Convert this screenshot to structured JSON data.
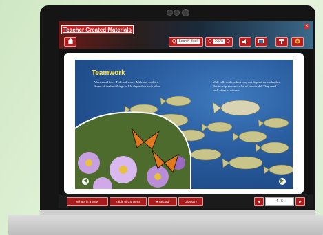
{
  "app": {
    "logo_text": "Teacher Created Materials",
    "close_glyph": "x"
  },
  "toolbar": {
    "home_icon": "home-icon",
    "search_label": "Search Book",
    "zoom_value": "100%",
    "buttons": [
      "zoom-in-icon",
      "zoom-out-icon",
      "audio-icon",
      "bookmark-icon",
      "tools-icon",
      "settings-icon"
    ]
  },
  "page": {
    "title": "Teamwork",
    "left_text": "Weeds and bees. Fish and water. Milk and cookies. Some of the best things in life depend on each other.",
    "right_text": "Wall cells and cookies may not depend on each other. But most plants and a lot of insects do! They need each other to survive.",
    "prev_arrow": "◀",
    "next_arrow": "▶"
  },
  "footer": {
    "buttons": [
      "Whats in a View",
      "Table of Contents",
      "Record",
      "Glossary"
    ],
    "page_indicator": "4 - 5",
    "prev": "◀",
    "next": "▶"
  },
  "colors": {
    "accent": "#b91e1e",
    "title": "#ffe24a",
    "ocean": "#2a5d9f"
  }
}
